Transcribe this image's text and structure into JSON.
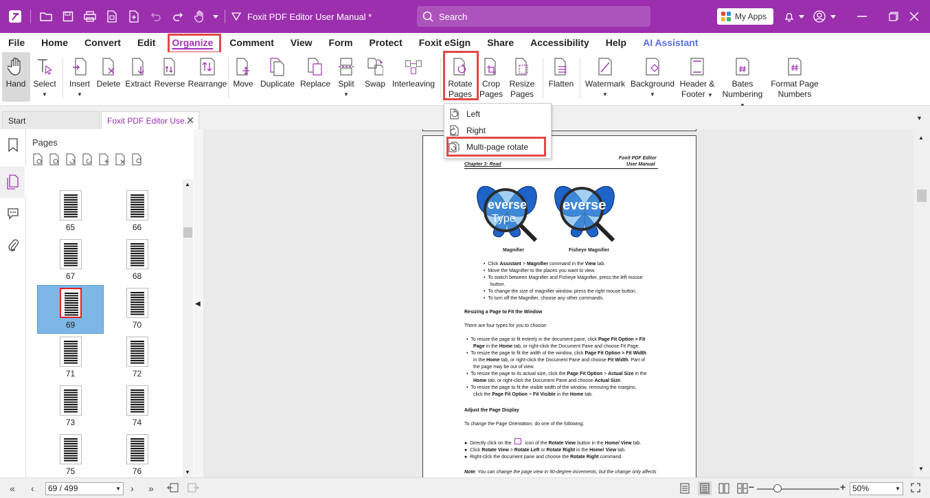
{
  "app": {
    "title": "Foxit PDF Editor User Manual *",
    "search_placeholder": "Search",
    "my_apps": "My Apps",
    "accent_color": "#9b2fae"
  },
  "menu": {
    "items": [
      "File",
      "Home",
      "Convert",
      "Edit",
      "Organize",
      "Comment",
      "View",
      "Form",
      "Protect",
      "Foxit eSign",
      "Share",
      "Accessibility",
      "Help",
      "AI Assistant"
    ],
    "active": "Organize"
  },
  "ribbon": {
    "hand": "Hand",
    "select": "Select",
    "insert": "Insert",
    "delete": "Delete",
    "extract": "Extract",
    "reverse": "Reverse",
    "rearrange": "Rearrange",
    "move": "Move",
    "duplicate": "Duplicate",
    "replace": "Replace",
    "split": "Split",
    "swap": "Swap",
    "interleaving": "Interleaving",
    "rotate_pages_1": "Rotate",
    "rotate_pages_2": "Pages",
    "crop_pages_1": "Crop",
    "crop_pages_2": "Pages",
    "resize_pages_1": "Resize",
    "resize_pages_2": "Pages",
    "flatten": "Flatten",
    "watermark": "Watermark",
    "background": "Background",
    "header_footer_1": "Header &",
    "header_footer_2": "Footer",
    "bates_1": "Bates",
    "bates_2": "Numbering",
    "format_1": "Format Page",
    "format_2": "Numbers"
  },
  "rotate_menu": {
    "left": "Left",
    "right": "Right",
    "multi": "Multi-page rotate"
  },
  "tabs": {
    "start": "Start",
    "doc": "Foxit PDF Editor Use..."
  },
  "pages_panel": {
    "title": "Pages",
    "thumbnails": [
      "65",
      "66",
      "67",
      "68",
      "69",
      "70",
      "71",
      "72",
      "73",
      "74",
      "75",
      "76"
    ],
    "selected": "69"
  },
  "document": {
    "chapter": "Chapter 3: Read",
    "header_right_1": "Foxit PDF Editor",
    "header_right_2": "User Manual",
    "img_word_1": "everse",
    "img_word_2": "Type",
    "img_word_3": "everse",
    "caption_left": "Magnifier",
    "caption_right": "Fisheye Magnifier",
    "b1_pre": "Click ",
    "b1_bold1": "Assistant",
    "b1_mid": " > ",
    "b1_bold2": "Magnifier",
    "b1_mid2": " command in the ",
    "b1_bold3": "View",
    "b1_end": " tab.",
    "b2": "Move the Magnifier to the places you want to view.",
    "b3a": "To switch between Magnifier and Fisheye Magnifier, press the left mouse",
    "b3b": "button.",
    "b4": "To change the size of magnifier window, press the right mouse button.",
    "b5": "To turn off the Magnifier, choose any other commands.",
    "h_resize": "Resizing a Page to Fit the Window",
    "p_types": "There are four types for you to choose:",
    "r1a_pre": "To resize the page to fit entirely in the document pane, click ",
    "r1a_bold": "Page Fit Option",
    "r1a_end": " > Fit",
    "r1b_bold": "Page",
    "r1b_mid": " in the ",
    "r1b_bold2": "Home",
    "r1b_end": " tab, or right-click the Document Pane and choose Fit Page.",
    "r2a_pre": "To resize the page to fit the width of the window, click ",
    "r2a_bold": "Page Fit Option",
    "r2a_end": " > Fit Width",
    "r2b_pre": "in the ",
    "r2b_bold": "Home",
    "r2b_mid": " tab, or right-click the Document Pane and choose ",
    "r2b_bold2": "Fit Width",
    "r2b_end": ". Part of",
    "r2c": "the page may be out of view.",
    "r3a_pre": "To resize the page to its actual size, click the ",
    "r3a_bold": "Page Fit Option",
    "r3a_mid": " > ",
    "r3a_bold2": "Actual Size",
    "r3a_end": " in the",
    "r3b_bold": "Home",
    "r3b_mid": " tab, or right-click the Document Pane and choose ",
    "r3b_bold2": "Actual Size",
    "r3b_end": ".",
    "r4a": "To resize the page to fit the visible width of the window, removing the margins,",
    "r4b_pre": "click the ",
    "r4b_bold": "Page Fit Option",
    "r4b_mid": " > ",
    "r4b_bold2": "Fit Visible",
    "r4b_mid2": " in the ",
    "r4b_bold3": "Home",
    "r4b_end": " tab.",
    "h_adjust": "Adjust the Page Display",
    "p_orient": "To change the Page Orientation, do one of the following:",
    "o1_pre": "Directly click on the ",
    "o1_mid": " icon of the ",
    "o1_bold": "Rotate View",
    "o1_mid2": " button in the ",
    "o1_bold2": "Home/ View",
    "o1_end": " tab.",
    "o2_pre": "Click ",
    "o2_bold": "Rotate View",
    "o2_mid": " > ",
    "o2_bold2": "Rotate Left",
    "o2_mid2": " or ",
    "o2_bold3": "Rotate Right",
    "o2_mid3": " in the ",
    "o2_bold4": "Home/ View",
    "o2_end": " tab.",
    "o3_pre": "Right-click the document pane and choose the ",
    "o3_bold": "Rotate Right",
    "o3_end": " command.",
    "note_bold": "Note",
    "note": ": You can change the page view in 90-degree increments, but the change only affects"
  },
  "status": {
    "page_value": "69 / 499",
    "zoom_value": "50%",
    "zoom_level": 0.25
  }
}
